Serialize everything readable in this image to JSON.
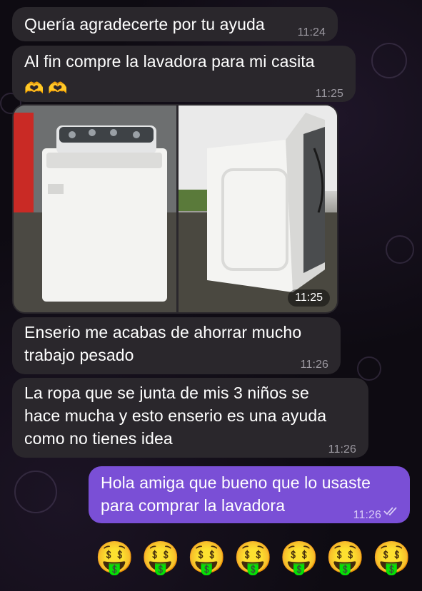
{
  "messages": [
    {
      "text": "Quería agradecerte por tu ayuda",
      "time": "11:24"
    },
    {
      "text": "Al fin compre la lavadora para mi casita",
      "emoji": "🫶🫶",
      "time": "11:25"
    },
    {
      "photo_time": "11:25"
    },
    {
      "text": "Enserio me acabas de ahorrar mucho\ntrabajo pesado",
      "time": "11:26"
    },
    {
      "text": "La ropa que se junta de mis 3 niños se\nhace mucha y esto enserio es una ayuda\ncomo no tienes idea",
      "time": "11:26"
    },
    {
      "text": "Hola amiga que bueno que lo usaste\npara comprar la lavadora",
      "time": "11:26",
      "status": "read"
    }
  ],
  "emoji_row": [
    "🤑",
    "🤑",
    "🤑",
    "🤑",
    "🤑",
    "🤑",
    "🤑"
  ],
  "colors": {
    "incoming": "#2a272c",
    "outgoing": "#7a4fd6",
    "background": "#0e0b12"
  }
}
